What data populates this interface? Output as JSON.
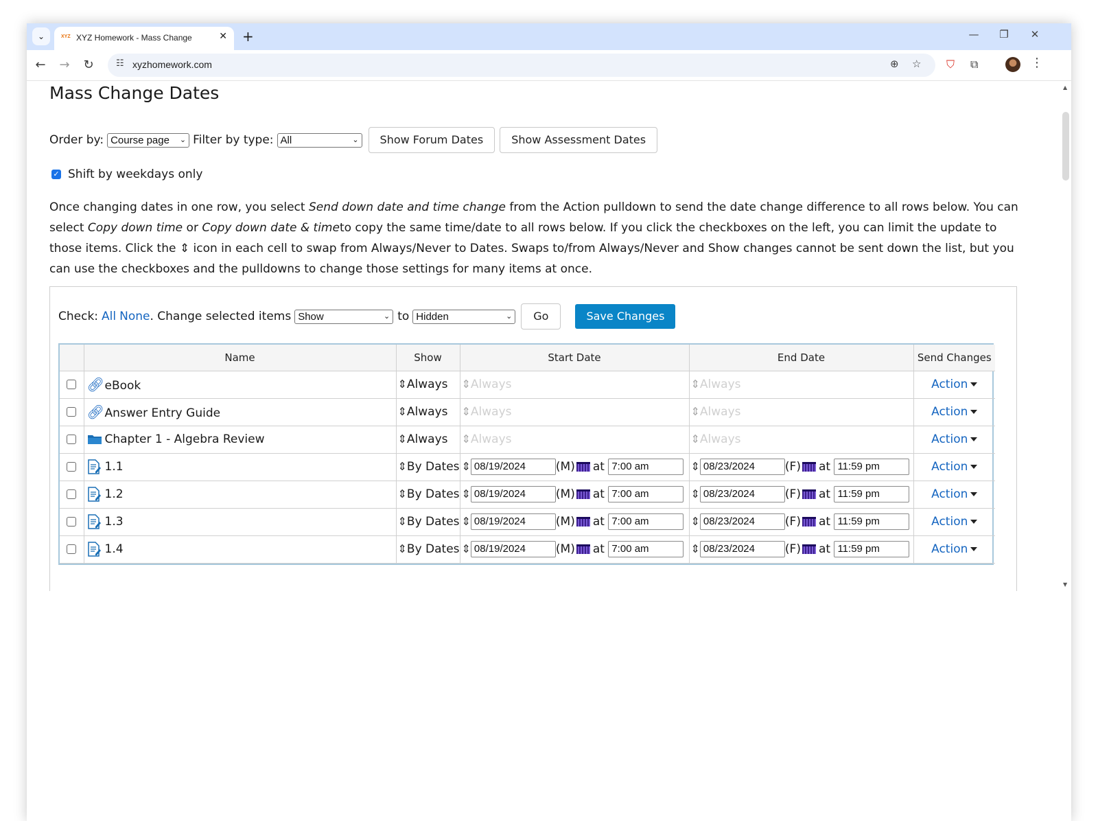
{
  "browser": {
    "tab_favicon": "XYZ",
    "tab_title": "XYZ Homework - Mass Change",
    "url": "xyzhomework.com"
  },
  "page": {
    "title": "Mass Change Dates",
    "order_by_label": "Order by:",
    "order_by_value": "Course page",
    "filter_label": "Filter by type:",
    "filter_value": "All",
    "show_forum_dates": "Show Forum Dates",
    "show_assessment_dates": "Show Assessment Dates",
    "shift_weekdays_label": "Shift by weekdays only",
    "shift_weekdays_checked": true,
    "instructions": {
      "p1": "Once changing dates in one row, you select ",
      "em1": "Send down date and time change",
      "p2": " from the Action pulldown to send the date change difference to all rows below. You can select ",
      "em2": "Copy down time",
      "p3": " or ",
      "em3": "Copy down date & time",
      "p4": "to copy the same time/date to all rows below. If you click the checkboxes on the left, you can limit the update to those items. Click the ",
      "p5": " icon in each cell to swap from Always/Never to Dates. Swaps to/from Always/Never and Show changes cannot be sent down the list, but you can use the checkboxes and the pulldowns to change those settings for many items at once."
    }
  },
  "bulk": {
    "check_label": "Check:",
    "all": "All",
    "none": "None",
    "change_label": ". Change selected items",
    "field_value": "Show",
    "to_label": "to",
    "target_value": "Hidden",
    "go": "Go",
    "save": "Save Changes"
  },
  "table": {
    "headers": [
      "",
      "Name",
      "Show",
      "Start Date",
      "End Date",
      "Send Changes"
    ],
    "action_label": "Action",
    "at_label": "at",
    "rows": [
      {
        "icon": "link-icon",
        "name": "eBook",
        "show": "Always",
        "mode": "always",
        "start": "Always",
        "end": "Always"
      },
      {
        "icon": "link-icon",
        "name": "Answer Entry Guide",
        "show": "Always",
        "mode": "always",
        "start": "Always",
        "end": "Always"
      },
      {
        "icon": "folder-icon",
        "name": "Chapter 1 - Algebra Review",
        "show": "Always",
        "mode": "always",
        "start": "Always",
        "end": "Always"
      },
      {
        "icon": "assessment-icon",
        "name": "1.1",
        "show": "By Dates",
        "mode": "dates",
        "start_date": "08/19/2024",
        "start_day": "(M)",
        "start_time": "7:00 am",
        "end_date": "08/23/2024",
        "end_day": "(F)",
        "end_time": "11:59 pm"
      },
      {
        "icon": "assessment-icon",
        "name": "1.2",
        "show": "By Dates",
        "mode": "dates",
        "start_date": "08/19/2024",
        "start_day": "(M)",
        "start_time": "7:00 am",
        "end_date": "08/23/2024",
        "end_day": "(F)",
        "end_time": "11:59 pm"
      },
      {
        "icon": "assessment-icon",
        "name": "1.3",
        "show": "By Dates",
        "mode": "dates",
        "start_date": "08/19/2024",
        "start_day": "(M)",
        "start_time": "7:00 am",
        "end_date": "08/23/2024",
        "end_day": "(F)",
        "end_time": "11:59 pm"
      },
      {
        "icon": "assessment-icon",
        "name": "1.4",
        "show": "By Dates",
        "mode": "dates",
        "start_date": "08/19/2024",
        "start_day": "(M)",
        "start_time": "7:00 am",
        "end_date": "08/23/2024",
        "end_day": "(F)",
        "end_time": "11:59 pm"
      }
    ]
  },
  "colors": {
    "link": "#1565c0",
    "primary_button": "#0a85c7",
    "table_border": "#a8c8dc",
    "tab_strip": "#d3e3fd"
  }
}
